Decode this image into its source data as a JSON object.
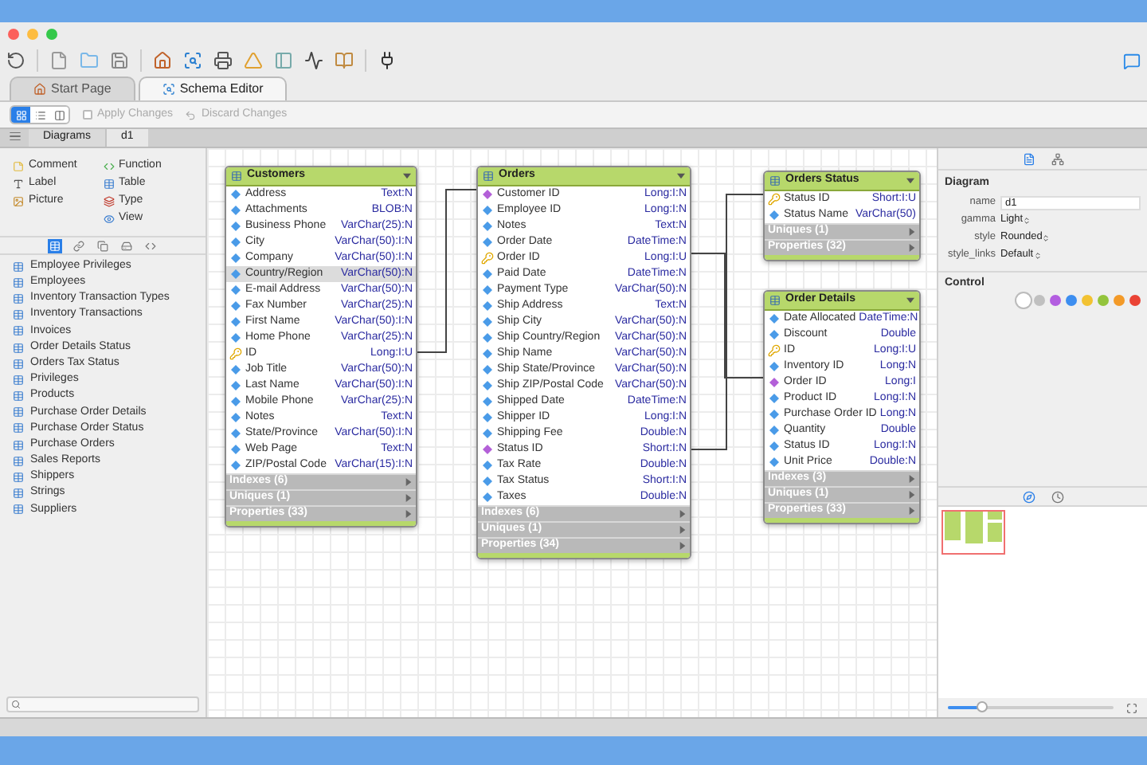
{
  "doc_tabs": [
    {
      "label": "Start Page",
      "kind": "home",
      "selected": false
    },
    {
      "label": "Schema Editor",
      "kind": "schema",
      "selected": true
    }
  ],
  "subtoolbar": {
    "views": [
      {
        "kind": "diagram",
        "selected": true
      },
      {
        "kind": "list",
        "selected": false
      },
      {
        "kind": "columns",
        "selected": false
      }
    ],
    "apply": {
      "label": "Apply Changes",
      "checked": false,
      "disabled": true
    },
    "discard": {
      "label": "Discard Changes",
      "disabled": true
    }
  },
  "panel_tabs": [
    {
      "label": "Diagrams",
      "selected": false
    },
    {
      "label": "d1",
      "selected": true
    }
  ],
  "palette": {
    "left": [
      {
        "label": "Comment",
        "kind": "comment"
      },
      {
        "label": "Label",
        "kind": "label"
      },
      {
        "label": "Picture",
        "kind": "picture"
      }
    ],
    "right": [
      {
        "label": "Function",
        "kind": "function"
      },
      {
        "label": "Table",
        "kind": "table"
      },
      {
        "label": "Type",
        "kind": "type"
      },
      {
        "label": "View",
        "kind": "view"
      }
    ]
  },
  "list_tabs": [
    {
      "kind": "table",
      "selected": true
    },
    {
      "kind": "link",
      "selected": false
    },
    {
      "kind": "copy",
      "selected": false
    },
    {
      "kind": "disk",
      "selected": false
    },
    {
      "kind": "code",
      "selected": false
    }
  ],
  "objects": [
    "Employee Privileges",
    "Employees",
    "Inventory Transaction Types",
    "Inventory Transactions",
    "Invoices",
    "Order Details Status",
    "Orders Tax Status",
    "Privileges",
    "Products",
    "Purchase Order Details",
    "Purchase Order Status",
    "Purchase Orders",
    "Sales Reports",
    "Shippers",
    "Strings",
    "Suppliers"
  ],
  "tables": [
    {
      "name": "Customers",
      "columns": [
        {
          "name": "Address",
          "type": "Text:N",
          "kind": "plain",
          "selected": false
        },
        {
          "name": "Attachments",
          "type": "BLOB:N",
          "kind": "plain",
          "selected": false
        },
        {
          "name": "Business Phone",
          "type": "VarChar(25):N",
          "kind": "plain",
          "selected": false
        },
        {
          "name": "City",
          "type": "VarChar(50):I:N",
          "kind": "plain",
          "selected": false
        },
        {
          "name": "Company",
          "type": "VarChar(50):I:N",
          "kind": "plain",
          "selected": false
        },
        {
          "name": "Country/Region",
          "type": "VarChar(50):N",
          "kind": "plain",
          "selected": true
        },
        {
          "name": "E-mail Address",
          "type": "VarChar(50):N",
          "kind": "plain",
          "selected": false
        },
        {
          "name": "Fax Number",
          "type": "VarChar(25):N",
          "kind": "plain",
          "selected": false
        },
        {
          "name": "First Name",
          "type": "VarChar(50):I:N",
          "kind": "plain",
          "selected": false
        },
        {
          "name": "Home Phone",
          "type": "VarChar(25):N",
          "kind": "plain",
          "selected": false
        },
        {
          "name": "ID",
          "type": "Long:I:U",
          "kind": "primary",
          "selected": false
        },
        {
          "name": "Job Title",
          "type": "VarChar(50):N",
          "kind": "plain",
          "selected": false
        },
        {
          "name": "Last Name",
          "type": "VarChar(50):I:N",
          "kind": "plain",
          "selected": false
        },
        {
          "name": "Mobile Phone",
          "type": "VarChar(25):N",
          "kind": "plain",
          "selected": false
        },
        {
          "name": "Notes",
          "type": "Text:N",
          "kind": "plain",
          "selected": false
        },
        {
          "name": "State/Province",
          "type": "VarChar(50):I:N",
          "kind": "plain",
          "selected": false
        },
        {
          "name": "Web Page",
          "type": "Text:N",
          "kind": "plain",
          "selected": false
        },
        {
          "name": "ZIP/Postal Code",
          "type": "VarChar(15):I:N",
          "kind": "plain",
          "selected": false
        }
      ],
      "sections": [
        "Indexes (6)",
        "Uniques (1)",
        "Properties (33)"
      ]
    },
    {
      "name": "Orders",
      "columns": [
        {
          "name": "Customer ID",
          "type": "Long:I:N",
          "kind": "foreign",
          "selected": false
        },
        {
          "name": "Employee ID",
          "type": "Long:I:N",
          "kind": "plain",
          "selected": false
        },
        {
          "name": "Notes",
          "type": "Text:N",
          "kind": "plain",
          "selected": false
        },
        {
          "name": "Order Date",
          "type": "DateTime:N",
          "kind": "plain",
          "selected": false
        },
        {
          "name": "Order ID",
          "type": "Long:I:U",
          "kind": "primary",
          "selected": false
        },
        {
          "name": "Paid Date",
          "type": "DateTime:N",
          "kind": "plain",
          "selected": false
        },
        {
          "name": "Payment Type",
          "type": "VarChar(50):N",
          "kind": "plain",
          "selected": false
        },
        {
          "name": "Ship Address",
          "type": "Text:N",
          "kind": "plain",
          "selected": false
        },
        {
          "name": "Ship City",
          "type": "VarChar(50):N",
          "kind": "plain",
          "selected": false
        },
        {
          "name": "Ship Country/Region",
          "type": "VarChar(50):N",
          "kind": "plain",
          "selected": false
        },
        {
          "name": "Ship Name",
          "type": "VarChar(50):N",
          "kind": "plain",
          "selected": false
        },
        {
          "name": "Ship State/Province",
          "type": "VarChar(50):N",
          "kind": "plain",
          "selected": false
        },
        {
          "name": "Ship ZIP/Postal Code",
          "type": "VarChar(50):N",
          "kind": "plain",
          "selected": false
        },
        {
          "name": "Shipped Date",
          "type": "DateTime:N",
          "kind": "plain",
          "selected": false
        },
        {
          "name": "Shipper ID",
          "type": "Long:I:N",
          "kind": "plain",
          "selected": false
        },
        {
          "name": "Shipping Fee",
          "type": "Double:N",
          "kind": "plain",
          "selected": false
        },
        {
          "name": "Status ID",
          "type": "Short:I:N",
          "kind": "foreign",
          "selected": false
        },
        {
          "name": "Tax Rate",
          "type": "Double:N",
          "kind": "plain",
          "selected": false
        },
        {
          "name": "Tax Status",
          "type": "Short:I:N",
          "kind": "plain",
          "selected": false
        },
        {
          "name": "Taxes",
          "type": "Double:N",
          "kind": "plain",
          "selected": false
        }
      ],
      "sections": [
        "Indexes (6)",
        "Uniques (1)",
        "Properties (34)"
      ]
    },
    {
      "name": "Orders Status",
      "columns": [
        {
          "name": "Status ID",
          "type": "Short:I:U",
          "kind": "primary",
          "selected": false
        },
        {
          "name": "Status Name",
          "type": "VarChar(50)",
          "kind": "plain",
          "selected": false
        }
      ],
      "sections": [
        "Uniques (1)",
        "Properties (32)"
      ]
    },
    {
      "name": "Order Details",
      "columns": [
        {
          "name": "Date Allocated",
          "type": "DateTime:N",
          "kind": "plain",
          "selected": false
        },
        {
          "name": "Discount",
          "type": "Double",
          "kind": "plain",
          "selected": false
        },
        {
          "name": "ID",
          "type": "Long:I:U",
          "kind": "primary",
          "selected": false
        },
        {
          "name": "Inventory ID",
          "type": "Long:N",
          "kind": "plain",
          "selected": false
        },
        {
          "name": "Order ID",
          "type": "Long:I",
          "kind": "foreign",
          "selected": false
        },
        {
          "name": "Product ID",
          "type": "Long:I:N",
          "kind": "plain",
          "selected": false
        },
        {
          "name": "Purchase Order ID",
          "type": "Long:N",
          "kind": "plain",
          "selected": false
        },
        {
          "name": "Quantity",
          "type": "Double",
          "kind": "plain",
          "selected": false
        },
        {
          "name": "Status ID",
          "type": "Long:I:N",
          "kind": "plain",
          "selected": false
        },
        {
          "name": "Unit Price",
          "type": "Double:N",
          "kind": "plain",
          "selected": false
        }
      ],
      "sections": [
        "Indexes (3)",
        "Uniques (1)",
        "Properties (33)"
      ]
    }
  ],
  "inspector": {
    "tabs": [
      {
        "kind": "document",
        "selected": true
      },
      {
        "kind": "hierarchy",
        "selected": false
      }
    ],
    "section": "Diagram",
    "fields": [
      {
        "label": "name",
        "value": "d1",
        "kind": "text"
      },
      {
        "label": "gamma",
        "value": "Light",
        "kind": "select"
      },
      {
        "label": "style",
        "value": "Rounded",
        "kind": "select"
      },
      {
        "label": "style_links",
        "value": "Default",
        "kind": "select"
      }
    ],
    "control_heading": "Control",
    "colors": [
      {
        "color": "#ffffff",
        "selected": true
      },
      {
        "color": "#c0c0c0",
        "selected": false
      },
      {
        "color": "#b35ee0",
        "selected": false
      },
      {
        "color": "#3d8ef0",
        "selected": false
      },
      {
        "color": "#f2c232",
        "selected": false
      },
      {
        "color": "#93c43c",
        "selected": false
      },
      {
        "color": "#f39a28",
        "selected": false
      },
      {
        "color": "#ea4335",
        "selected": false
      }
    ]
  },
  "navigator": {
    "tabs": [
      {
        "kind": "compass",
        "selected": true
      },
      {
        "kind": "clock",
        "selected": false
      }
    ],
    "zoom": {
      "level": 0.2
    }
  }
}
